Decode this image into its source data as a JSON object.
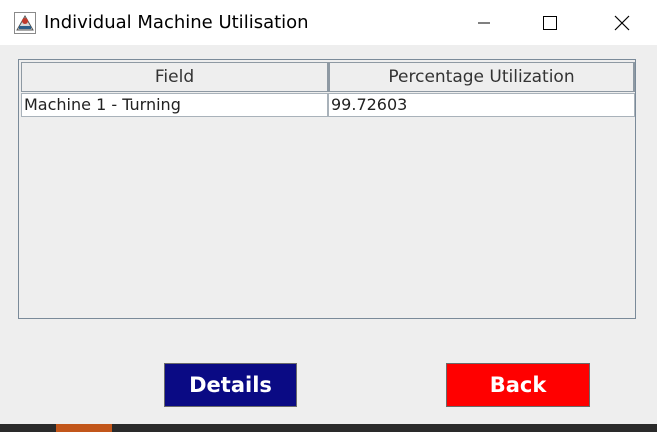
{
  "window": {
    "title": "Individual Machine Utilisation",
    "icon": "java-app-icon"
  },
  "titlebar_controls": [
    "minimize-icon",
    "maximize-icon",
    "close-icon"
  ],
  "table": {
    "columns": [
      "Field",
      "Percentage Utilization"
    ],
    "rows": [
      [
        "Machine 1 - Turning",
        "99.72603"
      ]
    ]
  },
  "buttons": {
    "details_label": "Details",
    "back_label": "Back"
  },
  "colors": {
    "details_bg": "#0a0a84",
    "back_bg": "#ff0000",
    "window_bg": "#eeeeee"
  }
}
